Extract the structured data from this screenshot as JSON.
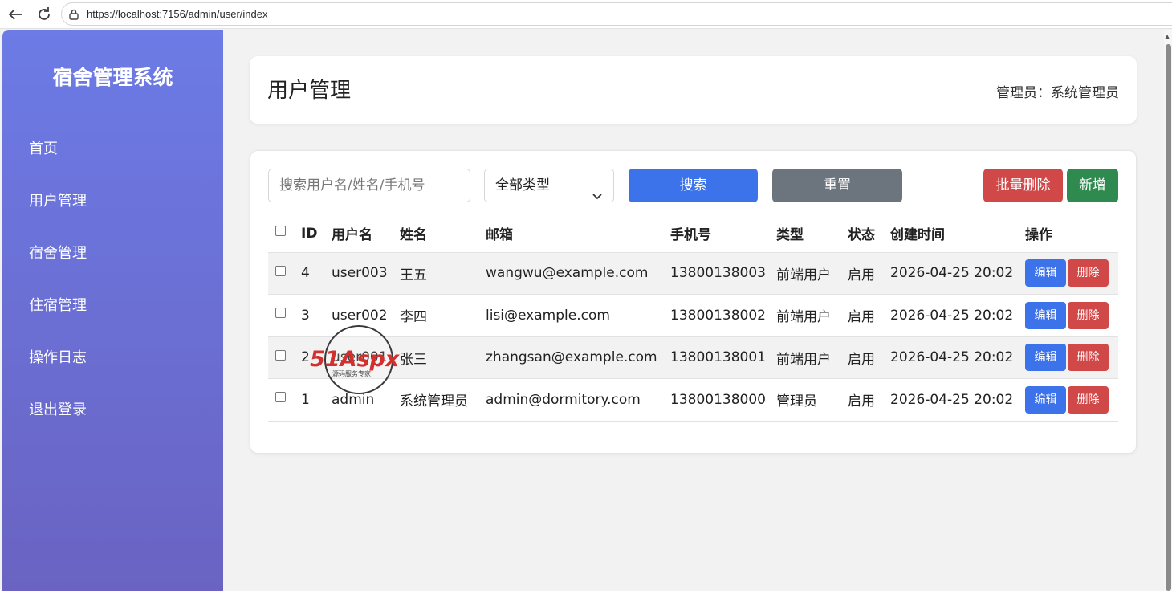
{
  "browser": {
    "url": "https://localhost:7156/admin/user/index"
  },
  "sidebar": {
    "brand": "宿舍管理系统",
    "items": [
      {
        "label": "首页"
      },
      {
        "label": "用户管理"
      },
      {
        "label": "宿舍管理"
      },
      {
        "label": "住宿管理"
      },
      {
        "label": "操作日志"
      },
      {
        "label": "退出登录"
      }
    ]
  },
  "header": {
    "title": "用户管理",
    "admin_label": "管理员：系统管理员"
  },
  "toolbar": {
    "search_placeholder": "搜索用户名/姓名/手机号",
    "type_selected": "全部类型",
    "search_label": "搜索",
    "reset_label": "重置",
    "batch_delete_label": "批量删除",
    "add_label": "新增"
  },
  "table": {
    "columns": [
      "ID",
      "用户名",
      "姓名",
      "邮箱",
      "手机号",
      "类型",
      "状态",
      "创建时间",
      "操作"
    ],
    "rows": [
      {
        "id": "4",
        "username": "user003",
        "name": "王五",
        "email": "wangwu@example.com",
        "phone": "13800138003",
        "type": "前端用户",
        "status": "启用",
        "created": "2026-04-25 20:02"
      },
      {
        "id": "3",
        "username": "user002",
        "name": "李四",
        "email": "lisi@example.com",
        "phone": "13800138002",
        "type": "前端用户",
        "status": "启用",
        "created": "2026-04-25 20:02"
      },
      {
        "id": "2",
        "username": "user001",
        "name": "张三",
        "email": "zhangsan@example.com",
        "phone": "13800138001",
        "type": "前端用户",
        "status": "启用",
        "created": "2026-04-25 20:02"
      },
      {
        "id": "1",
        "username": "admin",
        "name": "系统管理员",
        "email": "admin@dormitory.com",
        "phone": "13800138000",
        "type": "管理员",
        "status": "启用",
        "created": "2026-04-25 20:02"
      }
    ],
    "edit_label": "编辑",
    "delete_label": "删除"
  },
  "watermark": {
    "text": "51Aspx",
    "subtext": "源码服务专家"
  },
  "colors": {
    "sidebar_top": "#6c7be6",
    "sidebar_bottom": "#6a63c2",
    "primary": "#3d73ea",
    "danger": "#d04848",
    "success": "#2f8a4f",
    "secondary": "#6c757d"
  }
}
